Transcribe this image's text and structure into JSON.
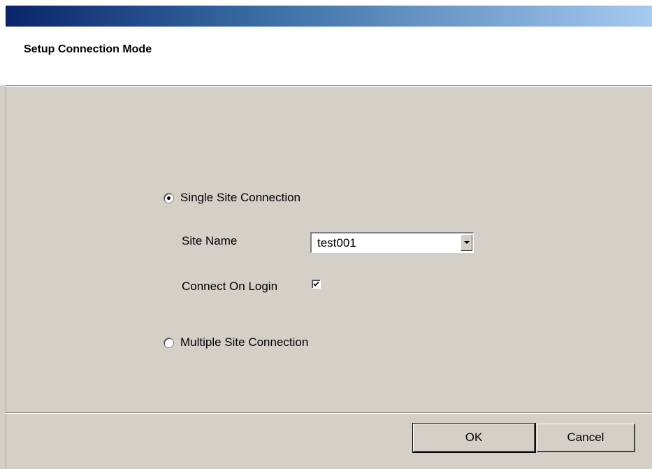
{
  "header": {
    "title": "Setup Connection Mode"
  },
  "options": {
    "single_site": {
      "label": "Single Site Connection",
      "selected": true
    },
    "site_name": {
      "label": "Site Name",
      "value": "test001"
    },
    "connect_on_login": {
      "label": "Connect On Login",
      "checked": true
    },
    "multiple_site": {
      "label": "Multiple Site Connection",
      "selected": false
    }
  },
  "buttons": {
    "ok_label": "OK",
    "cancel_label": "Cancel"
  },
  "colors": {
    "dialog_bg": "#d4d0c8",
    "header_bg": "#ffffff",
    "title_gradient_start": "#0a246a",
    "title_gradient_end": "#a6caf0"
  }
}
